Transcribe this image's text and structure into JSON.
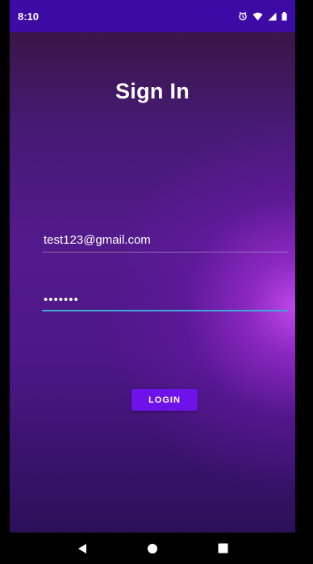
{
  "status_bar": {
    "time": "8:10",
    "icons": [
      "alarm-icon",
      "wifi-icon",
      "signal-icon",
      "battery-icon"
    ],
    "background": "#3d0aa6"
  },
  "screen": {
    "title": "Sign In",
    "email": {
      "value": "test123@gmail.com"
    },
    "password": {
      "value": "•••••••"
    },
    "login_label": "LOGIN",
    "accent": "#6e12ea",
    "focus_color": "#40a6d9"
  },
  "nav_bar": {
    "items": [
      "back-icon",
      "home-icon",
      "recents-icon"
    ]
  }
}
